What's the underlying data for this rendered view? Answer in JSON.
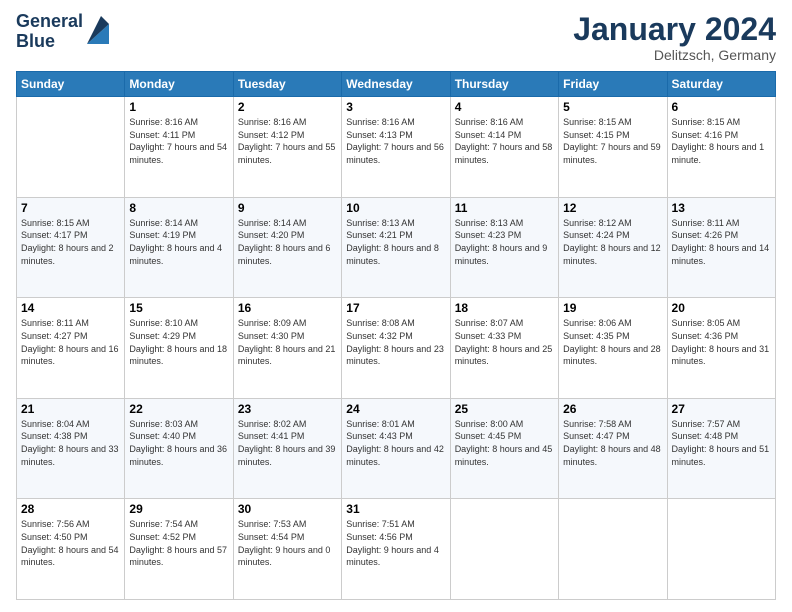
{
  "header": {
    "logo_line1": "General",
    "logo_line2": "Blue",
    "month": "January 2024",
    "location": "Delitzsch, Germany"
  },
  "weekdays": [
    "Sunday",
    "Monday",
    "Tuesday",
    "Wednesday",
    "Thursday",
    "Friday",
    "Saturday"
  ],
  "weeks": [
    [
      {
        "day": "",
        "sunrise": "",
        "sunset": "",
        "daylight": ""
      },
      {
        "day": "1",
        "sunrise": "Sunrise: 8:16 AM",
        "sunset": "Sunset: 4:11 PM",
        "daylight": "Daylight: 7 hours and 54 minutes."
      },
      {
        "day": "2",
        "sunrise": "Sunrise: 8:16 AM",
        "sunset": "Sunset: 4:12 PM",
        "daylight": "Daylight: 7 hours and 55 minutes."
      },
      {
        "day": "3",
        "sunrise": "Sunrise: 8:16 AM",
        "sunset": "Sunset: 4:13 PM",
        "daylight": "Daylight: 7 hours and 56 minutes."
      },
      {
        "day": "4",
        "sunrise": "Sunrise: 8:16 AM",
        "sunset": "Sunset: 4:14 PM",
        "daylight": "Daylight: 7 hours and 58 minutes."
      },
      {
        "day": "5",
        "sunrise": "Sunrise: 8:15 AM",
        "sunset": "Sunset: 4:15 PM",
        "daylight": "Daylight: 7 hours and 59 minutes."
      },
      {
        "day": "6",
        "sunrise": "Sunrise: 8:15 AM",
        "sunset": "Sunset: 4:16 PM",
        "daylight": "Daylight: 8 hours and 1 minute."
      }
    ],
    [
      {
        "day": "7",
        "sunrise": "Sunrise: 8:15 AM",
        "sunset": "Sunset: 4:17 PM",
        "daylight": "Daylight: 8 hours and 2 minutes."
      },
      {
        "day": "8",
        "sunrise": "Sunrise: 8:14 AM",
        "sunset": "Sunset: 4:19 PM",
        "daylight": "Daylight: 8 hours and 4 minutes."
      },
      {
        "day": "9",
        "sunrise": "Sunrise: 8:14 AM",
        "sunset": "Sunset: 4:20 PM",
        "daylight": "Daylight: 8 hours and 6 minutes."
      },
      {
        "day": "10",
        "sunrise": "Sunrise: 8:13 AM",
        "sunset": "Sunset: 4:21 PM",
        "daylight": "Daylight: 8 hours and 8 minutes."
      },
      {
        "day": "11",
        "sunrise": "Sunrise: 8:13 AM",
        "sunset": "Sunset: 4:23 PM",
        "daylight": "Daylight: 8 hours and 9 minutes."
      },
      {
        "day": "12",
        "sunrise": "Sunrise: 8:12 AM",
        "sunset": "Sunset: 4:24 PM",
        "daylight": "Daylight: 8 hours and 12 minutes."
      },
      {
        "day": "13",
        "sunrise": "Sunrise: 8:11 AM",
        "sunset": "Sunset: 4:26 PM",
        "daylight": "Daylight: 8 hours and 14 minutes."
      }
    ],
    [
      {
        "day": "14",
        "sunrise": "Sunrise: 8:11 AM",
        "sunset": "Sunset: 4:27 PM",
        "daylight": "Daylight: 8 hours and 16 minutes."
      },
      {
        "day": "15",
        "sunrise": "Sunrise: 8:10 AM",
        "sunset": "Sunset: 4:29 PM",
        "daylight": "Daylight: 8 hours and 18 minutes."
      },
      {
        "day": "16",
        "sunrise": "Sunrise: 8:09 AM",
        "sunset": "Sunset: 4:30 PM",
        "daylight": "Daylight: 8 hours and 21 minutes."
      },
      {
        "day": "17",
        "sunrise": "Sunrise: 8:08 AM",
        "sunset": "Sunset: 4:32 PM",
        "daylight": "Daylight: 8 hours and 23 minutes."
      },
      {
        "day": "18",
        "sunrise": "Sunrise: 8:07 AM",
        "sunset": "Sunset: 4:33 PM",
        "daylight": "Daylight: 8 hours and 25 minutes."
      },
      {
        "day": "19",
        "sunrise": "Sunrise: 8:06 AM",
        "sunset": "Sunset: 4:35 PM",
        "daylight": "Daylight: 8 hours and 28 minutes."
      },
      {
        "day": "20",
        "sunrise": "Sunrise: 8:05 AM",
        "sunset": "Sunset: 4:36 PM",
        "daylight": "Daylight: 8 hours and 31 minutes."
      }
    ],
    [
      {
        "day": "21",
        "sunrise": "Sunrise: 8:04 AM",
        "sunset": "Sunset: 4:38 PM",
        "daylight": "Daylight: 8 hours and 33 minutes."
      },
      {
        "day": "22",
        "sunrise": "Sunrise: 8:03 AM",
        "sunset": "Sunset: 4:40 PM",
        "daylight": "Daylight: 8 hours and 36 minutes."
      },
      {
        "day": "23",
        "sunrise": "Sunrise: 8:02 AM",
        "sunset": "Sunset: 4:41 PM",
        "daylight": "Daylight: 8 hours and 39 minutes."
      },
      {
        "day": "24",
        "sunrise": "Sunrise: 8:01 AM",
        "sunset": "Sunset: 4:43 PM",
        "daylight": "Daylight: 8 hours and 42 minutes."
      },
      {
        "day": "25",
        "sunrise": "Sunrise: 8:00 AM",
        "sunset": "Sunset: 4:45 PM",
        "daylight": "Daylight: 8 hours and 45 minutes."
      },
      {
        "day": "26",
        "sunrise": "Sunrise: 7:58 AM",
        "sunset": "Sunset: 4:47 PM",
        "daylight": "Daylight: 8 hours and 48 minutes."
      },
      {
        "day": "27",
        "sunrise": "Sunrise: 7:57 AM",
        "sunset": "Sunset: 4:48 PM",
        "daylight": "Daylight: 8 hours and 51 minutes."
      }
    ],
    [
      {
        "day": "28",
        "sunrise": "Sunrise: 7:56 AM",
        "sunset": "Sunset: 4:50 PM",
        "daylight": "Daylight: 8 hours and 54 minutes."
      },
      {
        "day": "29",
        "sunrise": "Sunrise: 7:54 AM",
        "sunset": "Sunset: 4:52 PM",
        "daylight": "Daylight: 8 hours and 57 minutes."
      },
      {
        "day": "30",
        "sunrise": "Sunrise: 7:53 AM",
        "sunset": "Sunset: 4:54 PM",
        "daylight": "Daylight: 9 hours and 0 minutes."
      },
      {
        "day": "31",
        "sunrise": "Sunrise: 7:51 AM",
        "sunset": "Sunset: 4:56 PM",
        "daylight": "Daylight: 9 hours and 4 minutes."
      },
      {
        "day": "",
        "sunrise": "",
        "sunset": "",
        "daylight": ""
      },
      {
        "day": "",
        "sunrise": "",
        "sunset": "",
        "daylight": ""
      },
      {
        "day": "",
        "sunrise": "",
        "sunset": "",
        "daylight": ""
      }
    ]
  ]
}
